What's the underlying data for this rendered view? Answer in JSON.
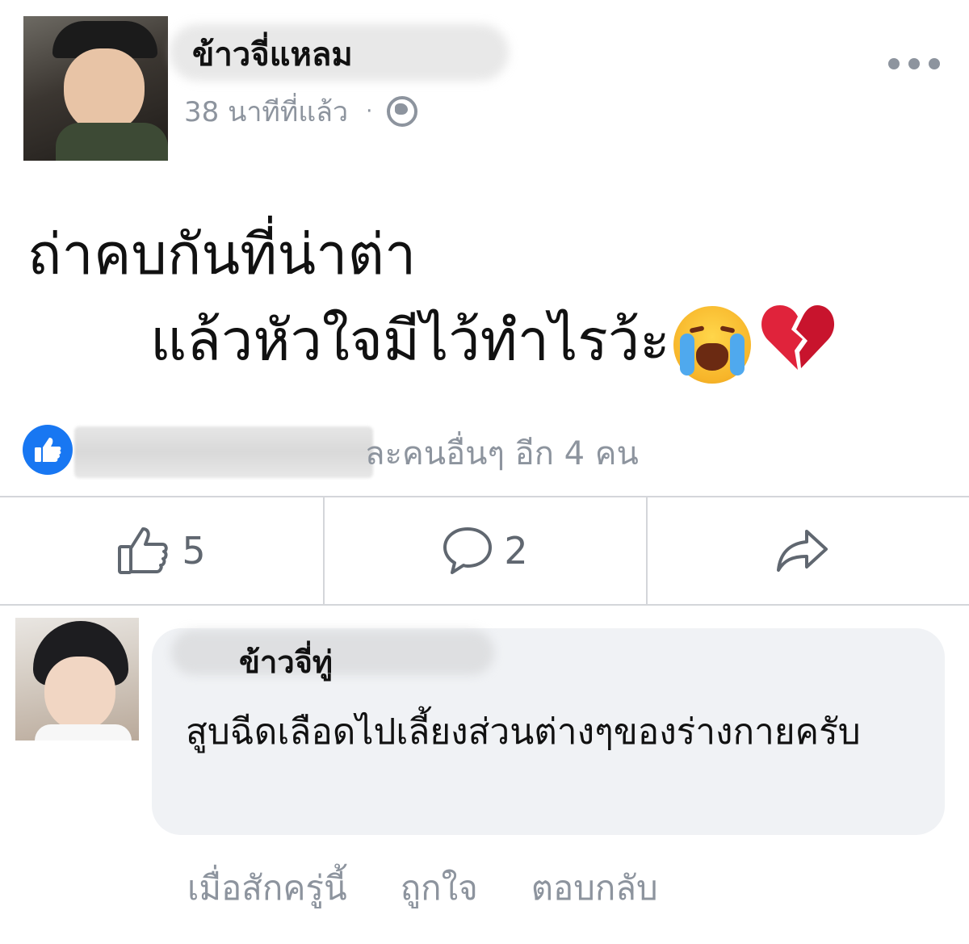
{
  "post": {
    "author": "ข้าวจี่แหลม",
    "time": "38 นาทีที่แล้ว",
    "separator": "·",
    "privacy_icon": "globe-icon",
    "text_line_1": "ถ่าคบกันที่น่าต่า",
    "text_line_2": "แล้วหัวใจมีไว้ทำไรว้ะ",
    "emojis": [
      "loudly-crying-face-icon",
      "broken-heart-icon"
    ]
  },
  "reactions": {
    "icon": "like-icon",
    "summary_text": "ละคนอื่นๆ อีก 4 คน"
  },
  "actions": {
    "like_count": "5",
    "comment_count": "2",
    "share_icon": "share-icon"
  },
  "comment": {
    "author": "ข้าวจี่ทู่",
    "text": "สูบฉีดเลือดไปเลี้ยงส่วนต่างๆของร่างกายครับ",
    "time": "เมื่อสักครู่นี้",
    "like_label": "ถูกใจ",
    "reply_label": "ตอบกลับ"
  },
  "colors": {
    "accent": "#1877f2",
    "muted_text": "#8d949e",
    "bubble": "#f0f2f5",
    "divider": "#d4d6da",
    "heart": "#e0233b"
  }
}
